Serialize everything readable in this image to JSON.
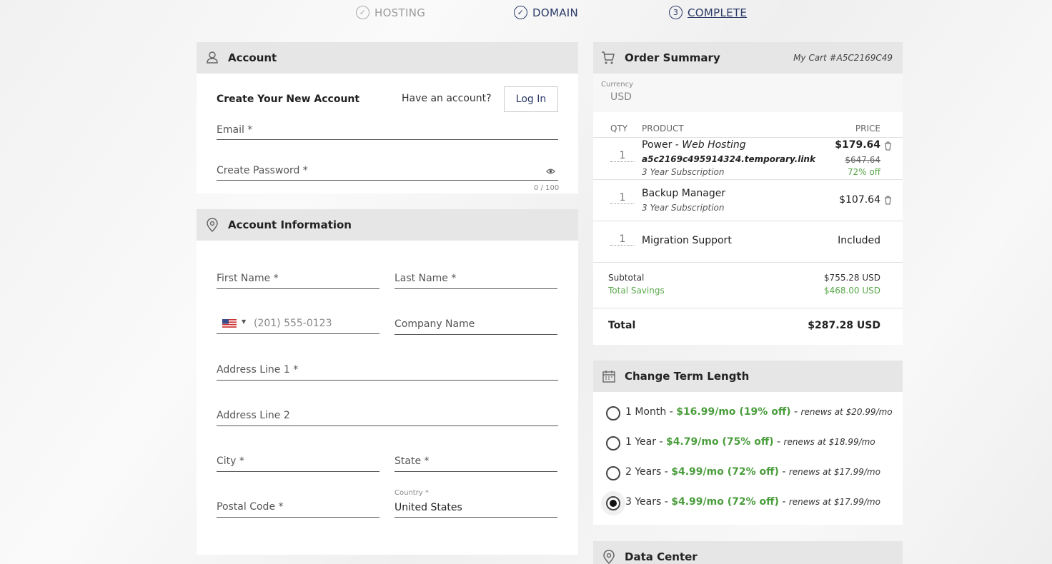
{
  "steps": [
    {
      "label": "HOSTING",
      "icon": "check-circle-icon"
    },
    {
      "label": "DOMAIN",
      "icon": "check-circle-icon"
    },
    {
      "number": "3",
      "label": "COMPLETE"
    }
  ],
  "account": {
    "title": "Account",
    "subtitle": "Create Your New Account",
    "have_account": "Have an account?",
    "login_label": "Log In",
    "email_label": "Email *",
    "password_label": "Create Password *",
    "password_counter": "0 / 100"
  },
  "account_info": {
    "title": "Account Information",
    "first_name": "First Name *",
    "last_name": "Last Name *",
    "phone_placeholder": "(201) 555-0123",
    "company": "Company Name",
    "address1": "Address Line 1 *",
    "address2": "Address Line 2",
    "city": "City *",
    "state": "State *",
    "postal": "Postal Code *",
    "country_label": "Country *",
    "country_value": "United States"
  },
  "order": {
    "title": "Order Summary",
    "cart_id": "My Cart #A5C2169C49",
    "currency_label": "Currency",
    "currency_value": "USD",
    "col_qty": "QTY",
    "col_product": "PRODUCT",
    "col_price": "PRICE",
    "items": [
      {
        "qty": "1",
        "name": "Power",
        "sep": " - ",
        "type": "Web Hosting",
        "domain": "a5c2169c495914324.temporary.link",
        "term": "3 Year Subscription",
        "price": "$179.64",
        "old_price": "$647.64",
        "discount": "72% off"
      },
      {
        "qty": "1",
        "name": "Backup Manager",
        "term": "3 Year Subscription",
        "price": "$107.64"
      },
      {
        "qty": "1",
        "name": "Migration Support",
        "price": "Included"
      }
    ],
    "subtotal_label": "Subtotal",
    "subtotal_value": "$755.28 USD",
    "savings_label": "Total Savings",
    "savings_value": "$468.00 USD",
    "total_label": "Total",
    "total_value": "$287.28 USD"
  },
  "term": {
    "title": "Change Term Length",
    "options": [
      {
        "label": "1 Month",
        "price": "$16.99/mo (19% off)",
        "renew": "renews at $20.99/mo",
        "selected": false
      },
      {
        "label": "1 Year",
        "price": "$4.79/mo (75% off)",
        "renew": "renews at $18.99/mo",
        "selected": false
      },
      {
        "label": "2 Years",
        "price": "$4.99/mo (72% off)",
        "renew": "renews at $17.99/mo",
        "selected": false
      },
      {
        "label": "3 Years",
        "price": "$4.99/mo (72% off)",
        "renew": "renews at $17.99/mo",
        "selected": true
      }
    ]
  },
  "data_center": {
    "title": "Data Center"
  },
  "colors": {
    "accent": "#2b3a67",
    "green": "#4a9d3c",
    "header_bg": "#e6e6e6"
  }
}
